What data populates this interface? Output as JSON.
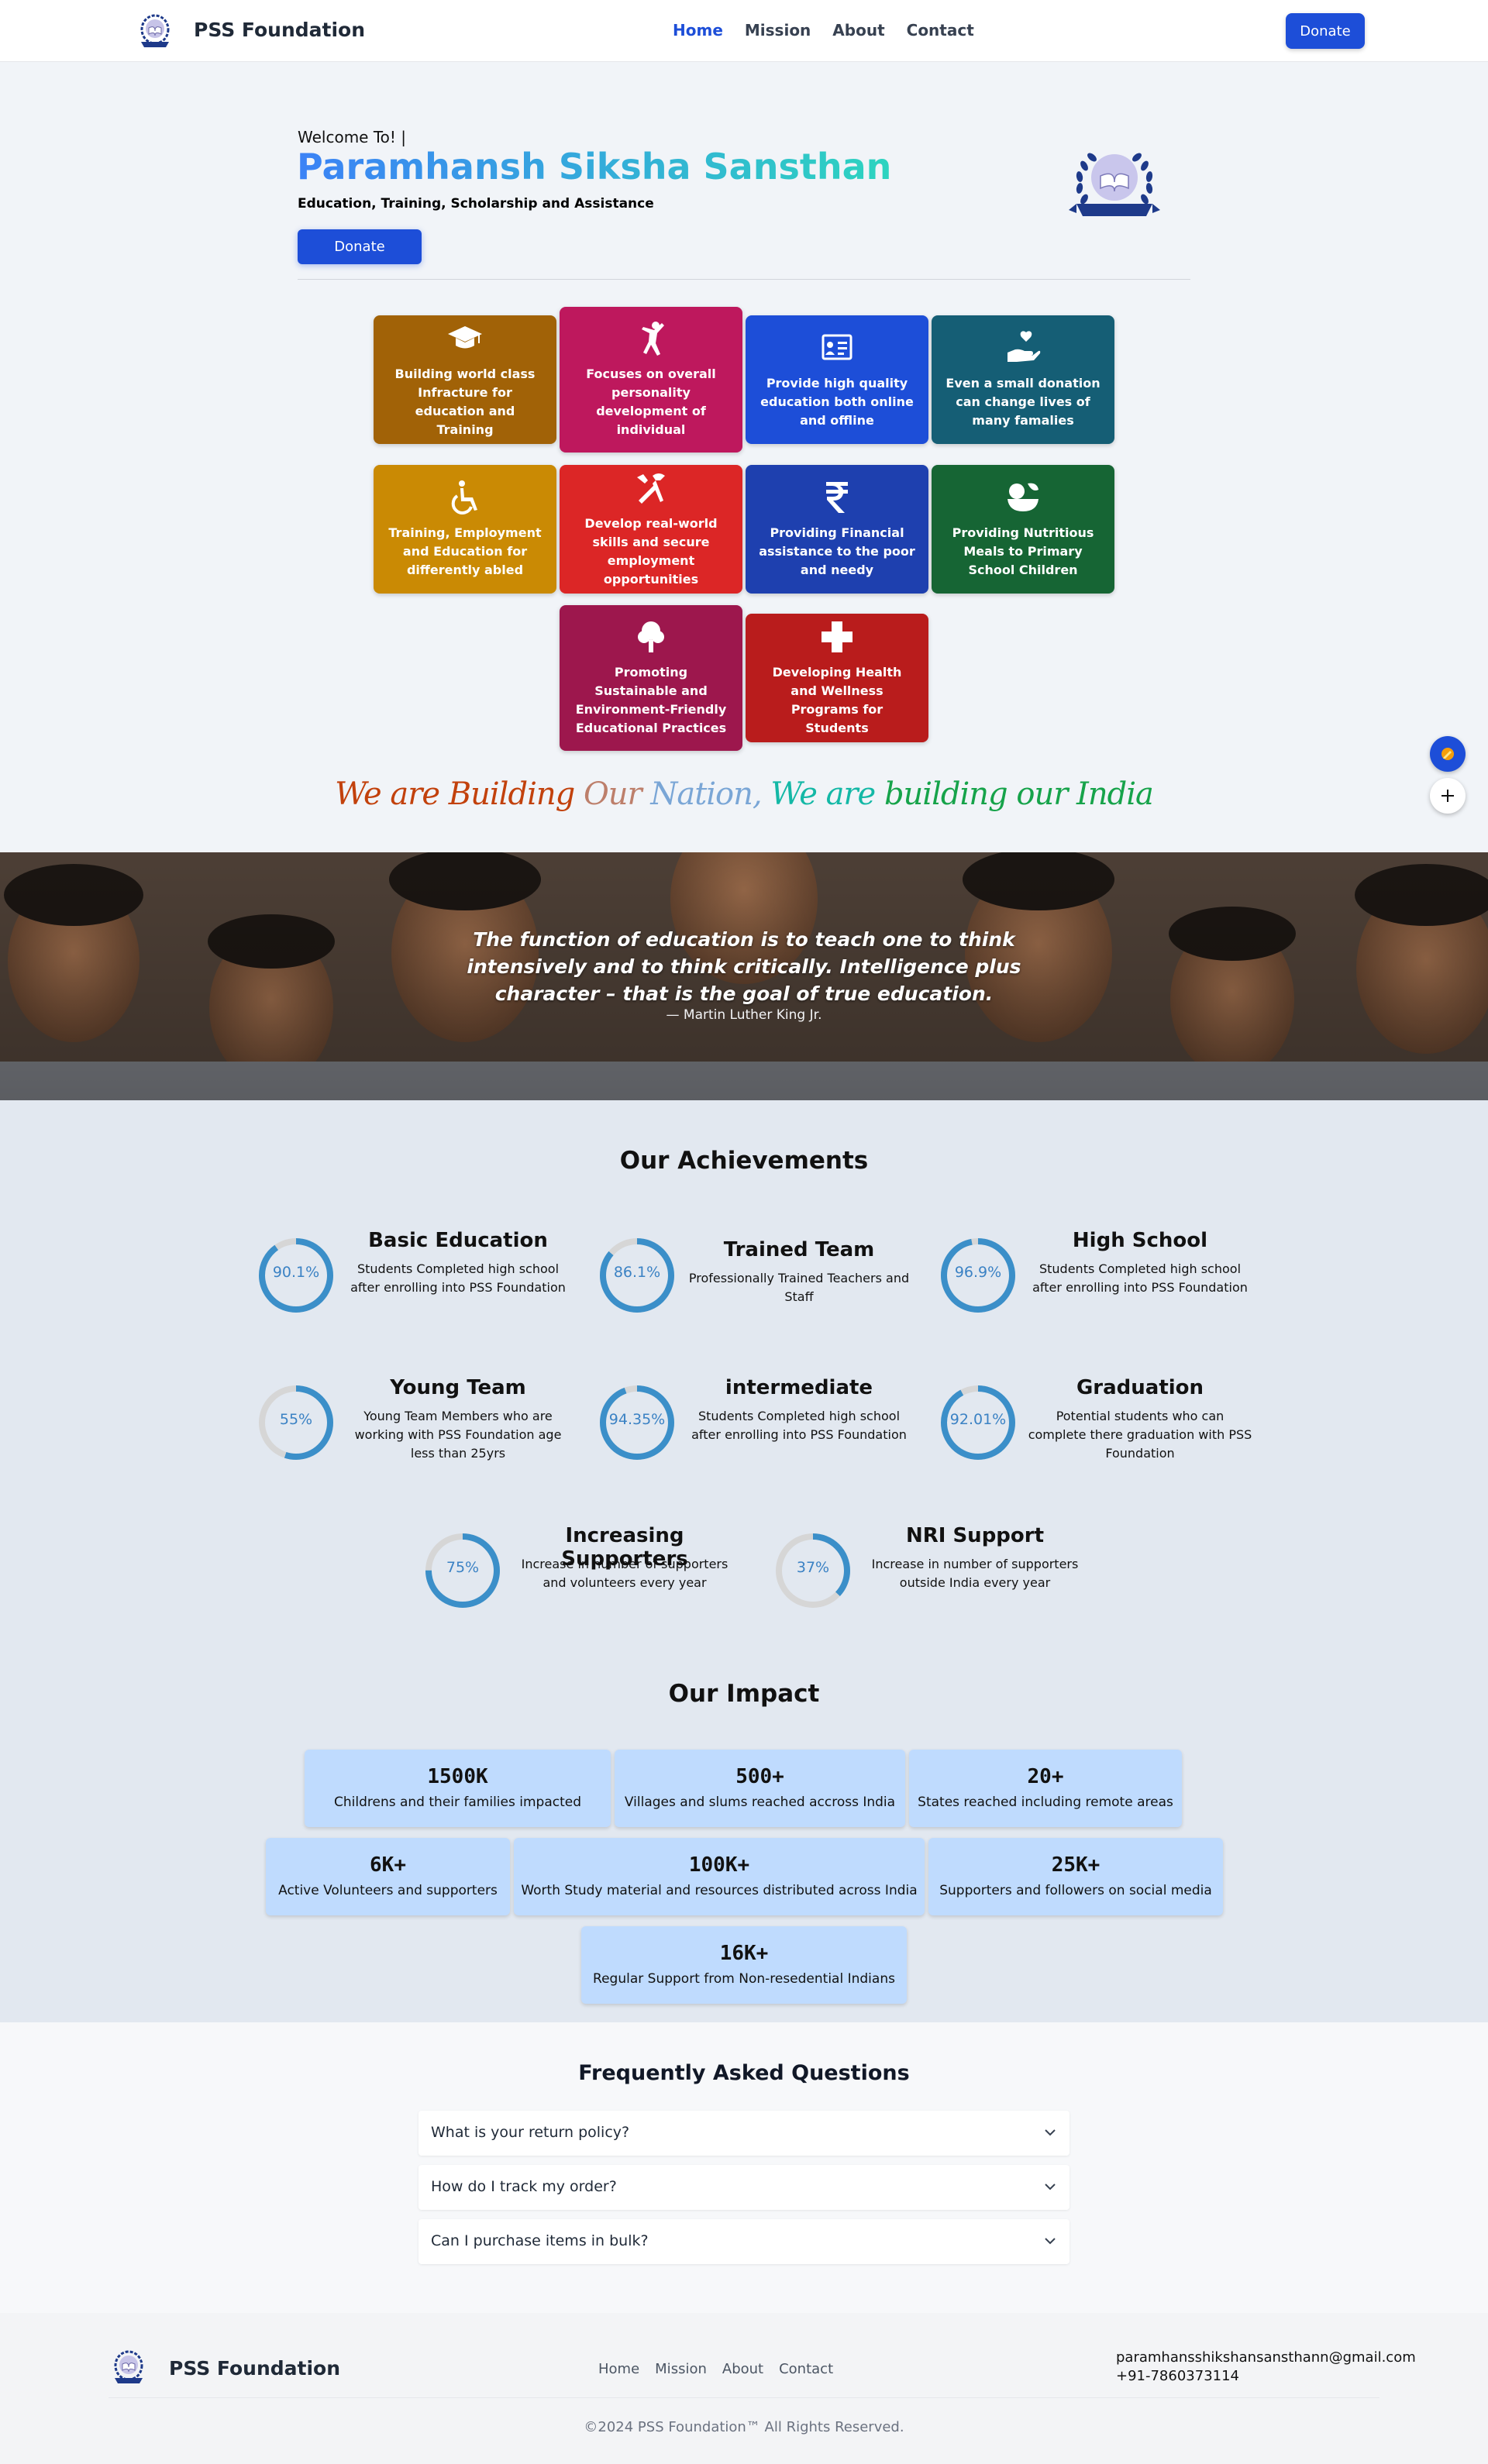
{
  "nav": {
    "brand": "PSS Foundation",
    "links": [
      "Home",
      "Mission",
      "About",
      "Contact"
    ],
    "donate": "Donate"
  },
  "hero": {
    "welcome": "Welcome To! |",
    "title": "Paramhansh Siksha Sansthan",
    "subtitle": "Education, Training, Scholarship and Assistance",
    "donate": "Donate"
  },
  "features": [
    {
      "text": "Building world class Infracture for education and Training",
      "color": "#a16207",
      "icon": "graduation-cap-icon"
    },
    {
      "text": "Focuses on overall personality development of individual",
      "color": "#be185d",
      "icon": "karate-person-icon"
    },
    {
      "text": "Provide high quality education both online and offline",
      "color": "#1d4ed8",
      "icon": "classroom-board-icon"
    },
    {
      "text": "Even a small donation can change lives of many famalies",
      "color": "#155e75",
      "icon": "hand-heart-icon"
    },
    {
      "text": "Training, Employment and Education for differently abled",
      "color": "#ca8a04",
      "icon": "wheelchair-icon"
    },
    {
      "text": "Develop real-world skills and secure employment opportunities",
      "color": "#dc2626",
      "icon": "tools-icon"
    },
    {
      "text": "Providing Financial assistance to the poor and needy",
      "color": "#1e40af",
      "icon": "rupee-icon"
    },
    {
      "text": "Providing Nutritious Meals to Primary School Children",
      "color": "#166534",
      "icon": "food-bowl-icon"
    },
    {
      "text": "Promoting Sustainable and Environment-Friendly Educational Practices",
      "color": "#9d174d",
      "icon": "tree-icon"
    },
    {
      "text": "Developing Health and Wellness Programs for Students",
      "color": "#b91c1c",
      "icon": "medical-cross-icon"
    }
  ],
  "tagline": {
    "part1": "We are Building ",
    "part2": "Our ",
    "part3": "Nation, ",
    "part4": "We are ",
    "part5": "building our India"
  },
  "quote": {
    "text": "The function of education is to teach one to think intensively and to think critically. Intelligence plus character – that is the goal of true education.",
    "author": "— Martin Luther King Jr."
  },
  "achievements": {
    "title": "Our Achievements",
    "items": [
      {
        "percent": "90.1%",
        "value": 90.1,
        "title": "Basic Education",
        "desc": "Students Completed high school after enrolling into PSS Foundation"
      },
      {
        "percent": "86.1%",
        "value": 86.1,
        "title": "Trained Team",
        "desc": "Professionally Trained Teachers and Staff"
      },
      {
        "percent": "96.9%",
        "value": 96.9,
        "title": "High School",
        "desc": "Students Completed high school after enrolling into PSS Foundation"
      },
      {
        "percent": "55%",
        "value": 55,
        "title": "Young Team",
        "desc": "Young Team Members who are working with PSS Foundation age less than 25yrs"
      },
      {
        "percent": "94.35%",
        "value": 94.35,
        "title": "intermediate",
        "desc": "Students Completed high school after enrolling into PSS Foundation"
      },
      {
        "percent": "92.01%",
        "value": 92.01,
        "title": "Graduation",
        "desc": "Potential students who can complete there graduation with PSS Foundation"
      },
      {
        "percent": "75%",
        "value": 75,
        "title": "Increasing Supporters",
        "desc": "Increase in number of supporters and volunteers every year"
      },
      {
        "percent": "37%",
        "value": 37,
        "title": "NRI Support",
        "desc": "Increase in number of supporters outside India every year"
      }
    ]
  },
  "impact": {
    "title": "Our Impact",
    "items": [
      {
        "num": "1500K",
        "label": "Childrens and their families impacted"
      },
      {
        "num": "500+",
        "label": "Villages and slums reached accross India"
      },
      {
        "num": "20+",
        "label": "States reached including remote areas"
      },
      {
        "num": "6K+",
        "label": "Active Volunteers and supporters"
      },
      {
        "num": "100K+",
        "label": "Worth Study material and resources distributed across India"
      },
      {
        "num": "25K+",
        "label": "Supporters and followers on social media"
      },
      {
        "num": "16K+",
        "label": "Regular Support from Non-resedential Indians"
      }
    ]
  },
  "faq": {
    "title": "Frequently Asked Questions",
    "items": [
      "What is your return policy?",
      "How do I track my order?",
      "Can I purchase items in bulk?"
    ]
  },
  "footer": {
    "brand": "PSS Foundation",
    "links": [
      "Home",
      "Mission",
      "About",
      "Contact"
    ],
    "email": "paramhansshikshansansthann@gmail.com",
    "phone": "+91-7860373114",
    "copyright": "©2024 PSS Foundation™ All Rights Reserved."
  },
  "colors": {
    "primary": "#1d4ed8",
    "ring": "#3b8fc9",
    "ring_track": "#d6d6d6",
    "impact_card": "#bfdbfe"
  }
}
